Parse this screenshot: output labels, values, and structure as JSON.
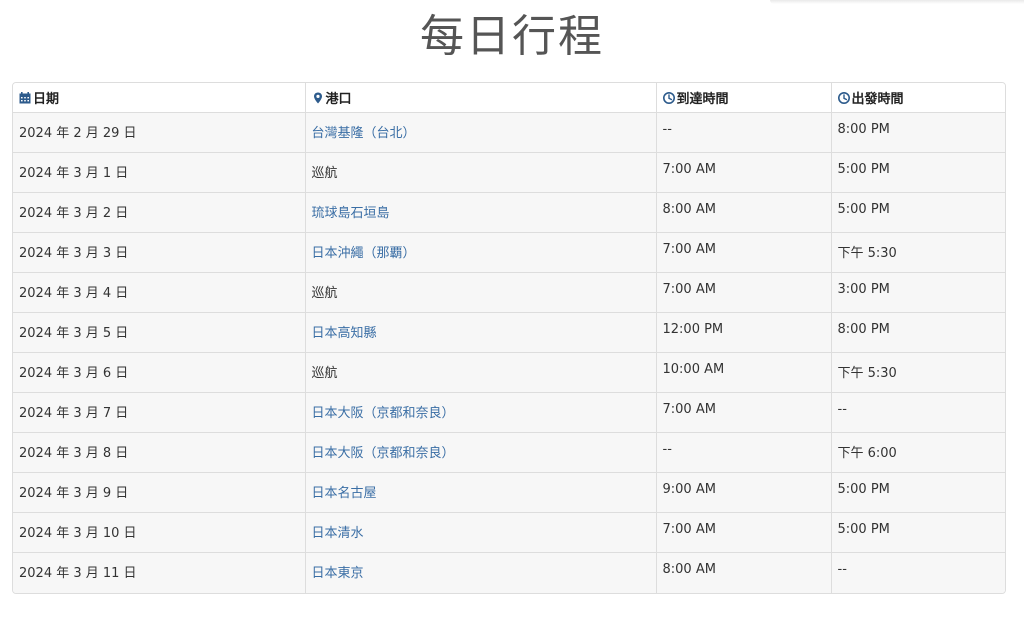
{
  "page": {
    "title": "每日行程"
  },
  "table": {
    "headers": [
      {
        "label": "日期",
        "icon": "calendar-icon"
      },
      {
        "label": "港口",
        "icon": "map-marker-icon"
      },
      {
        "label": "到達時間",
        "icon": "clock-icon"
      },
      {
        "label": "出發時間",
        "icon": "clock-icon"
      }
    ],
    "rows": [
      {
        "date": "2024 年 2 月 29 日",
        "port": "台灣基隆（台北）",
        "port_link": true,
        "arrive": "--",
        "depart": "8:00 PM"
      },
      {
        "date": "2024 年 3 月 1 日",
        "port": "巡航",
        "port_link": false,
        "arrive": "7:00 AM",
        "depart": "5:00 PM"
      },
      {
        "date": "2024 年 3 月 2 日",
        "port": "琉球島石垣島",
        "port_link": true,
        "arrive": "8:00 AM",
        "depart": "5:00 PM"
      },
      {
        "date": "2024 年 3 月 3 日",
        "port": "日本沖繩（那覇）",
        "port_link": true,
        "arrive": "7:00 AM",
        "depart": "下午 5:30"
      },
      {
        "date": "2024 年 3 月 4 日",
        "port": "巡航",
        "port_link": false,
        "arrive": "7:00 AM",
        "depart": "3:00 PM"
      },
      {
        "date": "2024 年 3 月 5 日",
        "port": "日本高知縣",
        "port_link": true,
        "arrive": "12:00 PM",
        "depart": "8:00 PM"
      },
      {
        "date": "2024 年 3 月 6 日",
        "port": "巡航",
        "port_link": false,
        "arrive": "10:00 AM",
        "depart": "下午 5:30"
      },
      {
        "date": "2024 年 3 月 7 日",
        "port": "日本大阪（京都和奈良）",
        "port_link": true,
        "arrive": "7:00 AM",
        "depart": "--"
      },
      {
        "date": "2024 年 3 月 8 日",
        "port": "日本大阪（京都和奈良）",
        "port_link": true,
        "arrive": "--",
        "depart": "下午 6:00"
      },
      {
        "date": "2024 年 3 月 9 日",
        "port": "日本名古屋",
        "port_link": true,
        "arrive": "9:00 AM",
        "depart": "5:00 PM"
      },
      {
        "date": "2024 年 3 月 10 日",
        "port": "日本清水",
        "port_link": true,
        "arrive": "7:00 AM",
        "depart": "5:00 PM"
      },
      {
        "date": "2024 年 3 月 11 日",
        "port": "日本東京",
        "port_link": true,
        "arrive": "8:00 AM",
        "depart": "--"
      }
    ]
  },
  "colors": {
    "link": "#3a6ea5",
    "icon": "#2d5b8c",
    "row_bg": "#f7f7f7",
    "border": "#dddddd"
  }
}
